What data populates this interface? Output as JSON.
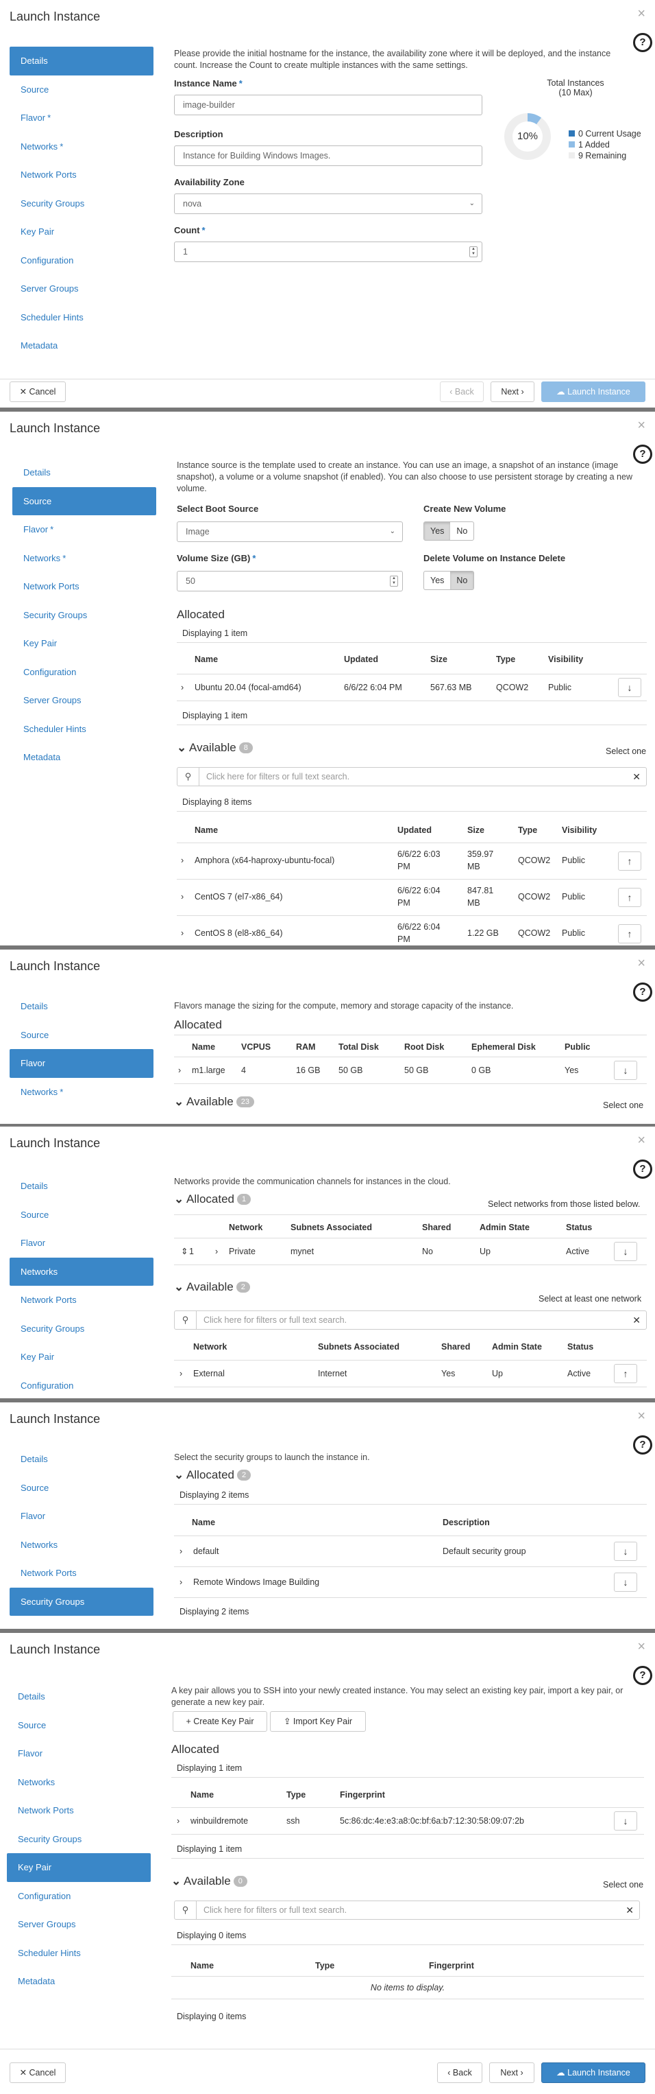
{
  "common": {
    "dialog_title": "Launch Instance",
    "close": "×",
    "help": "?",
    "cancel": "✕ Cancel",
    "back": "‹ Back",
    "next": "Next ›",
    "launch": "☁ Launch Instance",
    "required": "*",
    "nav": {
      "details": "Details",
      "source": "Source",
      "flavor": "Flavor",
      "networks": "Networks",
      "network_ports": "Network Ports",
      "security_groups": "Security Groups",
      "key_pair": "Key Pair",
      "configuration": "Configuration",
      "server_groups": "Server Groups",
      "scheduler_hints": "Scheduler Hints",
      "metadata": "Metadata"
    }
  },
  "details": {
    "description": "Please provide the initial hostname for the instance, the availability zone where it will be deployed, and the instance count. Increase the Count to create multiple instances with the same settings.",
    "instance_name_label": "Instance Name",
    "instance_name_value": "image-builder",
    "description_label": "Description",
    "description_value": "Instance for Building Windows Images.",
    "az_label": "Availability Zone",
    "az_value": "nova",
    "count_label": "Count",
    "count_value": "1",
    "total_instances_title": "Total Instances",
    "total_instances_max": "(10 Max)",
    "percent_label": "10%",
    "percent_value": 10,
    "legend_current": "0 Current Usage",
    "legend_added": "1 Added",
    "legend_remaining": "9 Remaining",
    "colors": {
      "current": "#2f78b9",
      "added": "#8fbde6",
      "remaining": "#eeeeee"
    }
  },
  "source": {
    "description": "Instance source is the template used to create an instance. You can use an image, a snapshot of an instance (image snapshot), a volume or a volume snapshot (if enabled). You can also choose to use persistent storage by creating a new volume.",
    "boot_source_label": "Select Boot Source",
    "boot_source_value": "Image",
    "create_volume_label": "Create New Volume",
    "yes": "Yes",
    "no": "No",
    "volume_size_label": "Volume Size (GB)",
    "volume_size_value": "50",
    "delete_volume_label": "Delete Volume on Instance Delete",
    "allocated_title": "Allocated",
    "displaying_1": "Displaying 1 item",
    "columns": [
      "Name",
      "Updated",
      "Size",
      "Type",
      "Visibility"
    ],
    "allocated_rows": [
      {
        "name": "Ubuntu 20.04 (focal-amd64)",
        "updated": "6/6/22 6:04 PM",
        "size": "567.63 MB",
        "type": "QCOW2",
        "visibility": "Public"
      }
    ],
    "available_title": "Available",
    "available_count": "8",
    "select_one": "Select one",
    "filter_placeholder": "Click here for filters or full text search.",
    "displaying_8": "Displaying 8 items",
    "available_rows": [
      {
        "name": "Amphora (x64-haproxy-ubuntu-focal)",
        "updated_1": "6/6/22 6:03",
        "updated_2": "PM",
        "size_1": "359.97",
        "size_2": "MB",
        "type": "QCOW2",
        "visibility": "Public"
      },
      {
        "name": "CentOS 7 (el7-x86_64)",
        "updated_1": "6/6/22 6:04",
        "updated_2": "PM",
        "size_1": "847.81",
        "size_2": "MB",
        "type": "QCOW2",
        "visibility": "Public"
      },
      {
        "name": "CentOS 8 (el8-x86_64)",
        "updated_1": "6/6/22 6:04",
        "updated_2": "PM",
        "size_1": "1.22 GB",
        "size_2": "",
        "type": "QCOW2",
        "visibility": "Public"
      }
    ]
  },
  "flavor": {
    "description": "Flavors manage the sizing for the compute, memory and storage capacity of the instance.",
    "allocated_title": "Allocated",
    "columns": [
      "Name",
      "VCPUS",
      "RAM",
      "Total Disk",
      "Root Disk",
      "Ephemeral Disk",
      "Public"
    ],
    "row": {
      "name": "m1.large",
      "vcpus": "4",
      "ram": "16 GB",
      "total_disk": "50 GB",
      "root_disk": "50 GB",
      "ephemeral": "0 GB",
      "public": "Yes"
    },
    "available_title": "Available",
    "available_count": "23",
    "select_one": "Select one"
  },
  "networks": {
    "description": "Networks provide the communication channels for instances in the cloud.",
    "allocated_title": "Allocated",
    "allocated_count": "1",
    "allocated_hint": "Select networks from those listed below.",
    "columns": [
      "Network",
      "Subnets Associated",
      "Shared",
      "Admin State",
      "Status"
    ],
    "allocated_row": {
      "order": "1",
      "network": "Private",
      "subnets": "mynet",
      "shared": "No",
      "admin": "Up",
      "status": "Active"
    },
    "available_title": "Available",
    "available_count": "2",
    "available_hint": "Select at least one network",
    "filter_placeholder": "Click here for filters or full text search.",
    "available_row": {
      "network": "External",
      "subnets": "Internet",
      "shared": "Yes",
      "admin": "Up",
      "status": "Active"
    }
  },
  "security": {
    "description": "Select the security groups to launch the instance in.",
    "allocated_title": "Allocated",
    "allocated_count": "2",
    "displaying": "Displaying 2 items",
    "columns": [
      "Name",
      "Description"
    ],
    "rows": [
      {
        "name": "default",
        "description": "Default security group"
      },
      {
        "name": "Remote Windows Image Building",
        "description": ""
      }
    ]
  },
  "keypair": {
    "description": "A key pair allows you to SSH into your newly created instance. You may select an existing key pair, import a key pair, or generate a new key pair.",
    "create_btn": "+ Create Key Pair",
    "import_btn": "⇪ Import Key Pair",
    "allocated_title": "Allocated",
    "displaying_1": "Displaying 1 item",
    "columns": [
      "Name",
      "Type",
      "Fingerprint"
    ],
    "row": {
      "name": "winbuildremote",
      "type": "ssh",
      "fingerprint": "5c:86:dc:4e:e3:a8:0c:bf:6a:b7:12:30:58:09:07:2b"
    },
    "available_title": "Available",
    "available_count": "0",
    "select_one": "Select one",
    "filter_placeholder": "Click here for filters or full text search.",
    "displaying_0": "Displaying 0 items",
    "empty": "No items to display."
  }
}
